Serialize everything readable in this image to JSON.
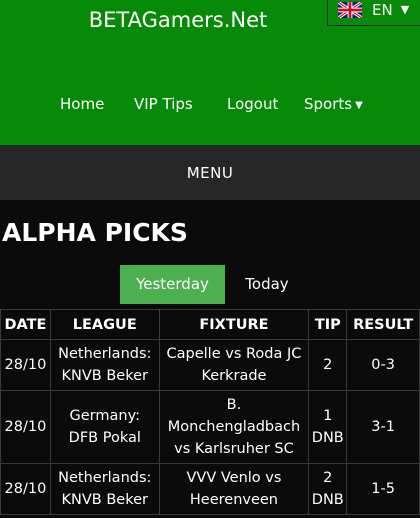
{
  "site": {
    "title": "BETAGamers.Net"
  },
  "language": {
    "code": "EN",
    "flag_icon": "uk-flag-icon"
  },
  "nav": {
    "home": "Home",
    "vip_tips": "VIP Tips",
    "logout": "Logout",
    "sports": "Sports"
  },
  "menu": {
    "label": "MENU"
  },
  "page": {
    "title": "ALPHA PICKS"
  },
  "tabs": {
    "yesterday": "Yesterday",
    "today": "Today",
    "active": "Yesterday"
  },
  "table": {
    "headers": {
      "date": "DATE",
      "league": "LEAGUE",
      "fixture": "FIXTURE",
      "tip": "TIP",
      "result": "RESULT"
    },
    "rows": [
      {
        "date": "28/10",
        "league": "Netherlands: KNVB Beker",
        "fixture": "Capelle vs Roda JC Kerkrade",
        "tip": "2",
        "result": "0-3"
      },
      {
        "date": "28/10",
        "league": "Germany: DFB Pokal",
        "fixture": "B. Monchengladbach vs Karlsruher SC",
        "tip": "1 DNB",
        "result": "3-1"
      },
      {
        "date": "28/10",
        "league": "Netherlands: KNVB Beker",
        "fixture": "VVV Venlo vs Heerenveen",
        "tip": "2 DNB",
        "result": "1-5"
      }
    ]
  },
  "colors": {
    "header_green": "#078a07",
    "tab_active": "#4caf50",
    "menu_bar": "#272727",
    "background": "#0b0b0b"
  }
}
